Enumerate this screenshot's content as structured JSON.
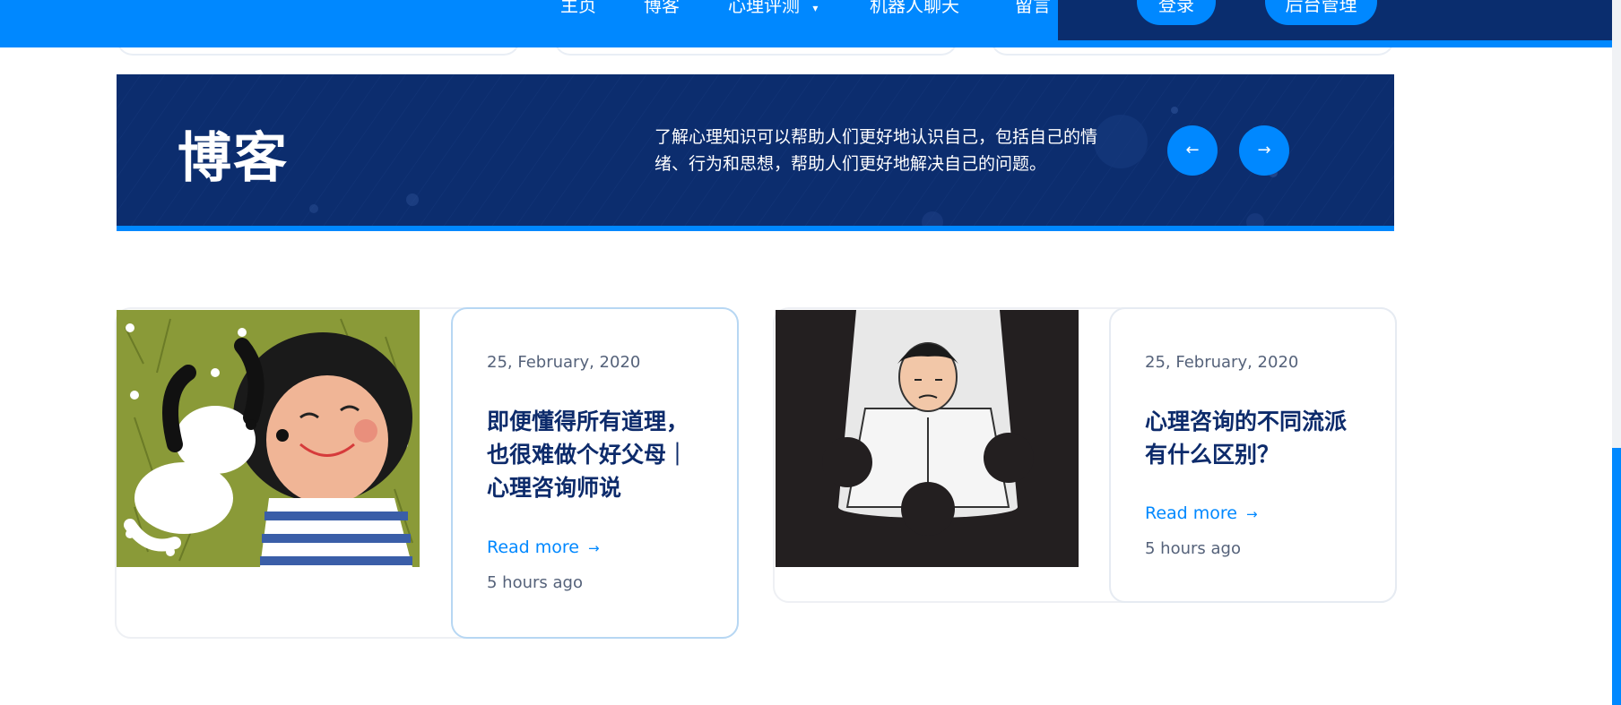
{
  "nav": {
    "items": [
      "主页",
      "博客",
      "心理评测",
      "机器人聊天",
      "留言"
    ],
    "login": "登录",
    "admin": "后台管理"
  },
  "banner": {
    "title": "博客",
    "description": "了解心理知识可以帮助人们更好地认识自己，包括自己的情绪、行为和思想，帮助人们更好地解决自己的问题。",
    "prev_icon": "arrow-left-icon",
    "next_icon": "arrow-right-icon"
  },
  "posts": [
    {
      "date": "25, February, 2020",
      "title": "即便懂得所有道理，也很难做个好父母｜心理咨询师说",
      "read_more": "Read more",
      "ago": "5 hours ago"
    },
    {
      "date": "25, February, 2020",
      "title": "心理咨询的不同流派有什么区别？",
      "read_more": "Read more",
      "ago": "5 hours ago"
    }
  ],
  "colors": {
    "primary": "#0088ff",
    "navy": "#0c2d6e",
    "title": "#0d2b6b"
  }
}
